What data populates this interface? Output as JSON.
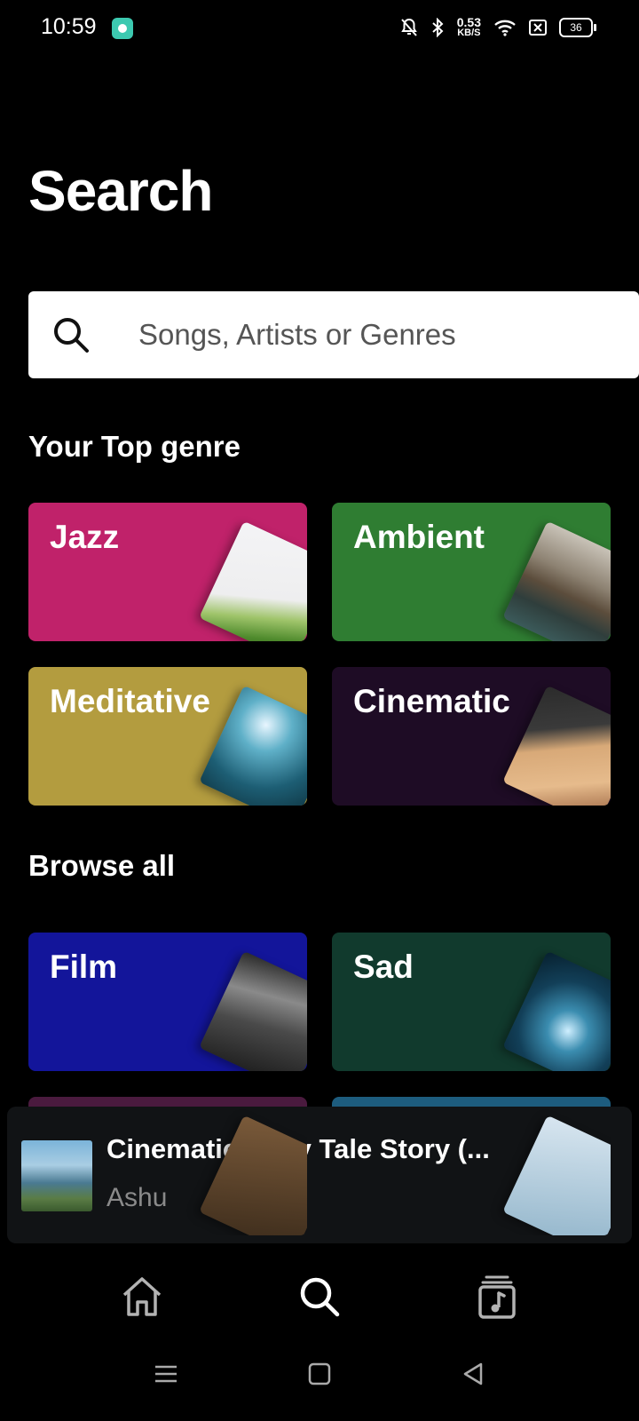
{
  "status_bar": {
    "time": "10:59",
    "net_speed_value": "0.53",
    "net_speed_unit": "KB/S",
    "battery": "36",
    "icons": [
      "app-notification-icon",
      "bell-off-icon",
      "bluetooth-icon",
      "wifi-icon",
      "sim-icon",
      "battery-icon"
    ]
  },
  "header": {
    "title": "Search"
  },
  "search": {
    "placeholder": "Songs, Artists or Genres",
    "value": ""
  },
  "top_genre": {
    "title": "Your Top genre",
    "items": [
      {
        "label": "Jazz",
        "color": "#c0226a"
      },
      {
        "label": "Ambient",
        "color": "#2f7d32"
      },
      {
        "label": "Meditative",
        "color": "#b39c3f"
      },
      {
        "label": "Cinematic",
        "color": "#1e0c25"
      }
    ]
  },
  "browse_all": {
    "title": "Browse all",
    "items": [
      {
        "label": "Film",
        "color": "#13159a"
      },
      {
        "label": "Sad",
        "color": "#113a2d"
      },
      {
        "label": "",
        "color": "#4a1a3e"
      },
      {
        "label": "",
        "color": "#1d5c7e"
      }
    ]
  },
  "mini_player": {
    "title": "Cinematic Fairy Tale Story (...",
    "artist": "Ashu",
    "icon": "play-icon"
  },
  "bottom_nav": {
    "items": [
      {
        "name": "home",
        "icon": "home-icon"
      },
      {
        "name": "search",
        "icon": "search-icon"
      },
      {
        "name": "library",
        "icon": "music-library-icon"
      }
    ]
  },
  "colors": {
    "background": "#000000",
    "search_bg": "#ffffff",
    "player_bg": "#111315",
    "muted_text": "#8a8a8a"
  }
}
